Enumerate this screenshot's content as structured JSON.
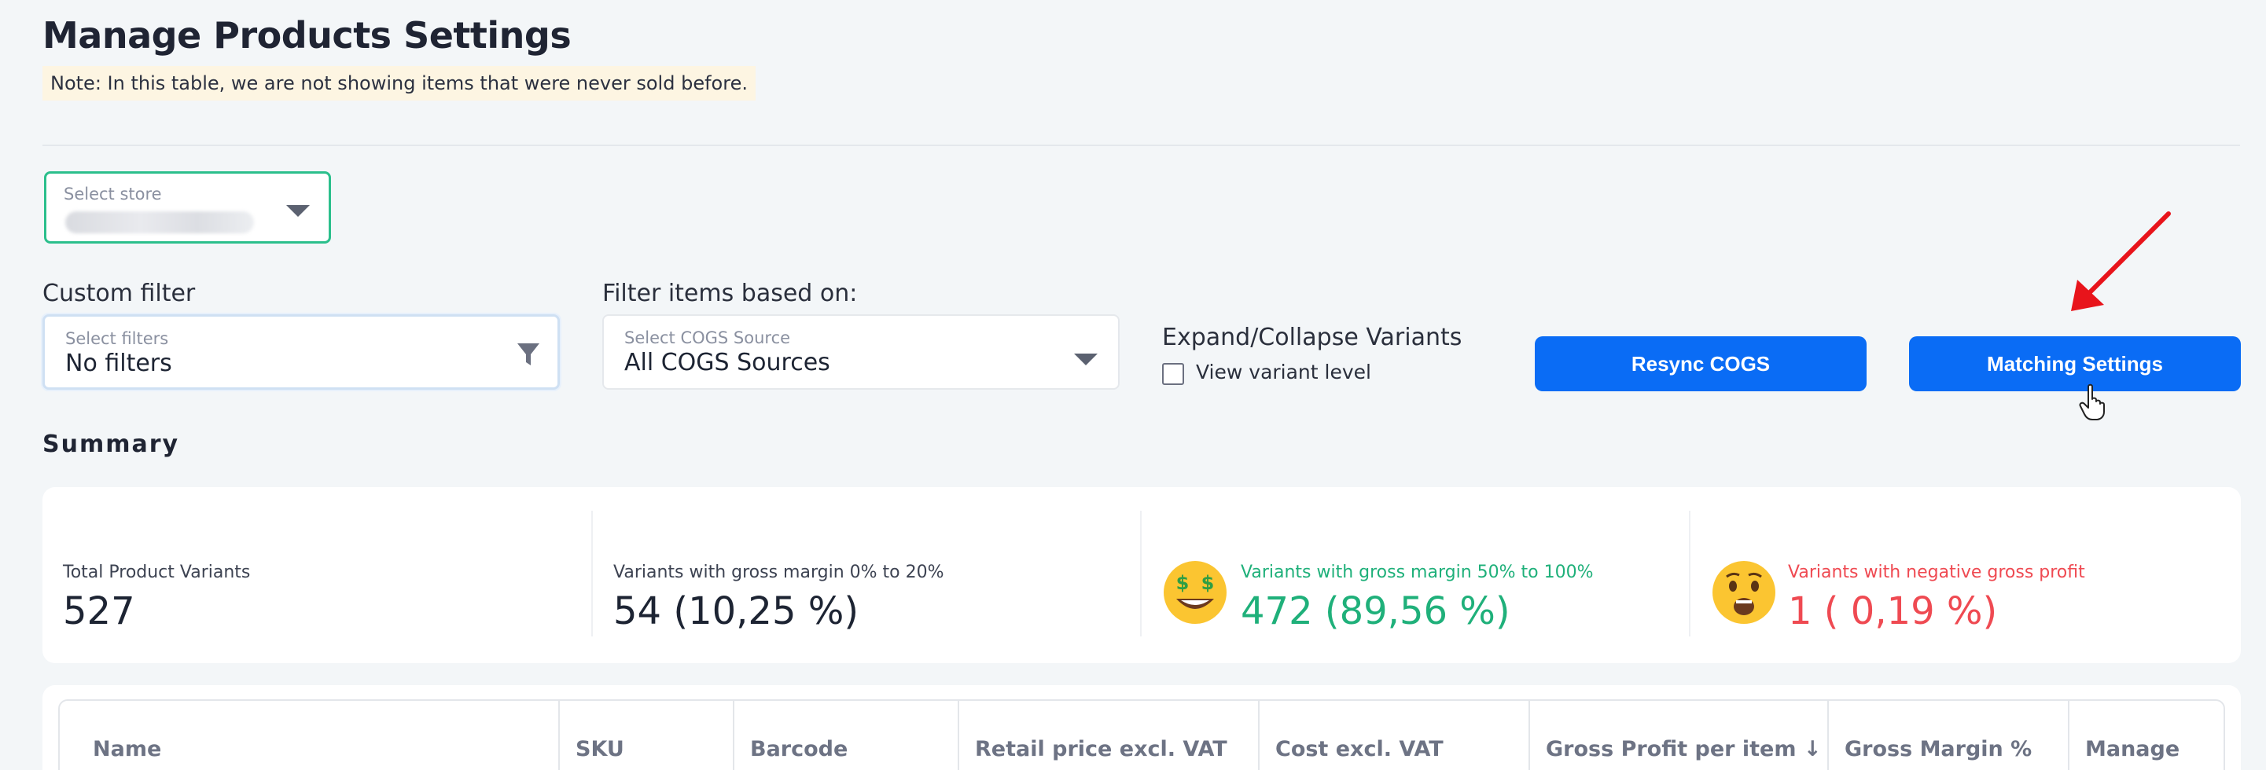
{
  "page": {
    "title": "Manage Products Settings",
    "note": "Note: In this table, we are not showing items that were never sold before."
  },
  "store_select": {
    "label": "Select store",
    "value": "",
    "value_state": "blurred"
  },
  "custom_filter": {
    "title": "Custom filter",
    "label": "Select filters",
    "value": "No filters",
    "icon": "funnel-icon"
  },
  "cogs_filter": {
    "title": "Filter items based on:",
    "label": "Select COGS Source",
    "value": "All COGS Sources"
  },
  "variants": {
    "title": "Expand/Collapse Variants",
    "checkbox_label": "View variant level",
    "checked": false
  },
  "buttons": {
    "resync": "Resync COGS",
    "matching": "Matching Settings"
  },
  "summary": {
    "title": "Summary",
    "stats": [
      {
        "label": "Total Product Variants",
        "value": "527",
        "tone": "neutral",
        "icon": ""
      },
      {
        "label": "Variants with gross margin 0% to 20%",
        "value": "54 (10,25 %)",
        "tone": "neutral",
        "icon": ""
      },
      {
        "label": "Variants with gross margin 50% to 100%",
        "value": "472 (89,56 %)",
        "tone": "green",
        "icon": "money-mouth-emoji-icon"
      },
      {
        "label": "Variants with negative gross profit",
        "value": "1 ( 0,19 %)",
        "tone": "red",
        "icon": "shocked-face-emoji-icon"
      }
    ]
  },
  "table": {
    "headers": [
      "Name",
      "SKU",
      "Barcode",
      "Retail price excl. VAT",
      "Cost excl. VAT",
      "Gross Profit per item ↓",
      "Gross Margin %",
      "Manage"
    ]
  },
  "colors": {
    "primary": "#0a6cf5",
    "green": "#1fb07a",
    "red": "#ef4a52",
    "note_bg": "#fdf5e2",
    "annotation_arrow": "#e8141b"
  }
}
